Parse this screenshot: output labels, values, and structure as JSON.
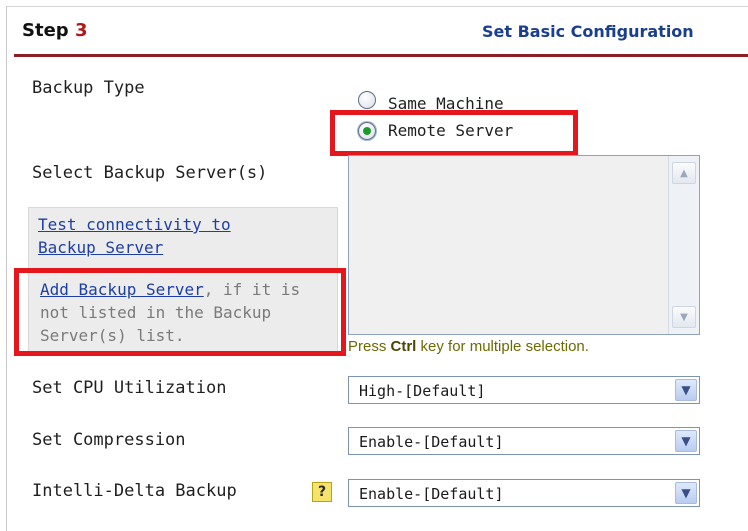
{
  "header": {
    "step_label": "Step",
    "step_number": "3",
    "title_right": "Set Basic Configuration"
  },
  "backup_type": {
    "label": "Backup Type",
    "options": [
      {
        "label": "Same Machine",
        "checked": false
      },
      {
        "label": "Remote Server",
        "checked": true
      }
    ]
  },
  "backup_servers": {
    "label": "Select Backup Server(s)",
    "items": [],
    "hint_prefix": "Press ",
    "hint_key": "Ctrl",
    "hint_suffix": " key for multiple selection."
  },
  "info_box": {
    "test_link_line1": "Test connectivity to",
    "test_link_line2": "Backup Server",
    "add_link": "Add Backup Server",
    "add_text_line1": ", if it is",
    "add_text_line2": "not listed in the Backup",
    "add_text_line3": "Server(s) list."
  },
  "cpu": {
    "label": "Set CPU Utilization",
    "value": "High-[Default]"
  },
  "compression": {
    "label": "Set Compression",
    "value": "Enable-[Default]"
  },
  "intelli_delta": {
    "label": "Intelli-Delta Backup",
    "help_glyph": "?",
    "value": "Enable-[Default]"
  },
  "colors": {
    "accent_red": "#e5161c",
    "header_rule": "#8a1f28",
    "header_link": "#1b3f8f"
  }
}
